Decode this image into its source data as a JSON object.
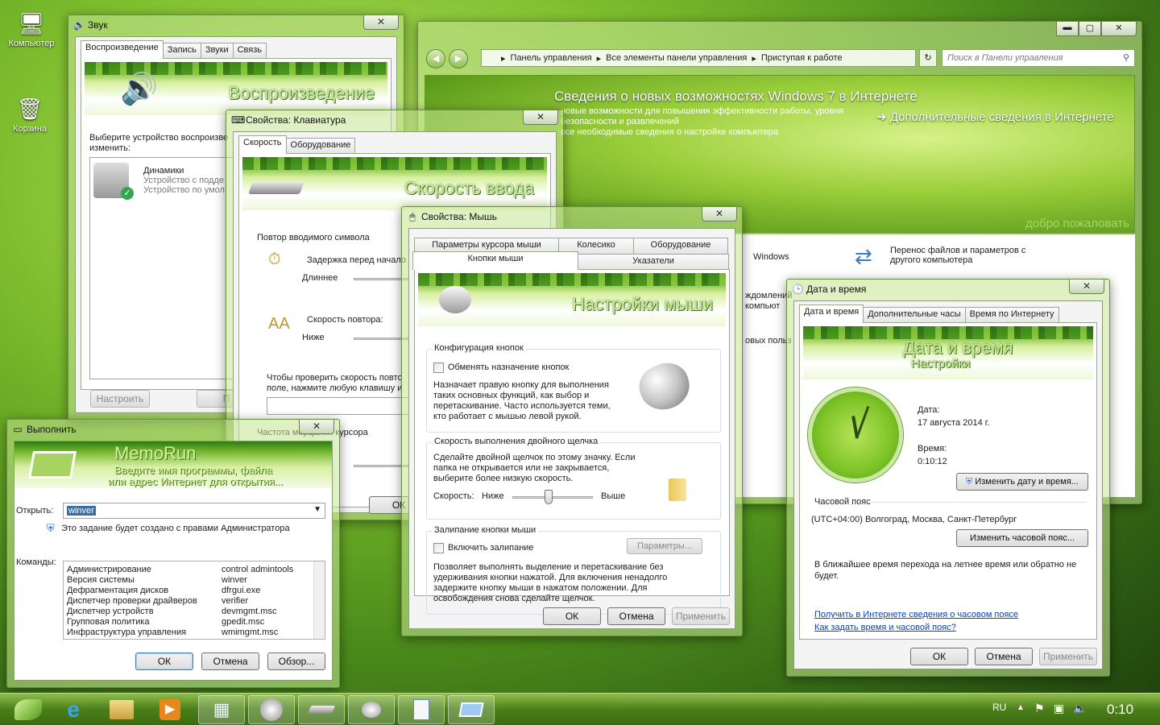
{
  "desktop": {
    "icons": [
      {
        "label": "Компьютер",
        "glyph": "🖥"
      },
      {
        "label": "Корзина",
        "glyph": "🗑"
      }
    ]
  },
  "sound": {
    "title": "Звук",
    "tabs": [
      "Воспроизведение",
      "Запись",
      "Звуки",
      "Связь"
    ],
    "banner": "Воспроизведение",
    "prompt": "Выберите устройство воспроизве",
    "prompt2": "изменить:",
    "device_name": "Динамики",
    "device_line1": "Устройство с подде",
    "device_line2": "Устройство по умол",
    "configure_btn": "Настроить",
    "btn2": "П"
  },
  "keyboard": {
    "title": "Свойства: Клавиатура",
    "tabs": [
      "Скорость",
      "Оборудование"
    ],
    "banner": "Скорость ввода",
    "group_repeat": "Повтор вводимого символа",
    "delay_label": "Задержка перед начало",
    "longer": "Длиннее",
    "repeat_label": "Скорость повтора:",
    "lower": "Ниже",
    "test_line1": "Чтобы проверить скорость повто",
    "test_line2": "поле, нажмите любую клавишу и",
    "cursor_blink": "Частота мерцания курсора",
    "ok_partial": "ОК"
  },
  "mouse": {
    "title": "Свойства: Мышь",
    "tabs_top": [
      "Параметры курсора мыши",
      "Колесико",
      "Оборудование"
    ],
    "tabs_bottom": [
      "Кнопки мыши",
      "Указатели"
    ],
    "banner": "Настройки мыши",
    "grp_buttons": "Конфигурация кнопок",
    "swap_label": "Обменять назначение кнопок",
    "swap_desc": [
      "Назначает правую кнопку для выполнения",
      "таких основных функций, как выбор и",
      "перетаскивание. Часто используется теми,",
      "кто работает с мышью левой рукой."
    ],
    "grp_dbl": "Скорость выполнения двойного щелчка",
    "dbl_desc": [
      "Сделайте двойной щелчок по этому значку. Если",
      "папка не открывается или не закрывается,",
      "выберите более низкую скорость."
    ],
    "speed": "Скорость:",
    "low": "Ниже",
    "high": "Выше",
    "speed_value": 0.45,
    "grp_lock": "Залипание кнопки мыши",
    "lock_label": "Включить залипание",
    "params_btn": "Параметры...",
    "lock_desc": [
      "Позволяет выполнять выделение и перетаскивание без",
      "удерживания кнопки нажатой. Для включения ненадолго",
      "задержите кнопку мыши в нажатом положении. Для",
      "освобождения снова сделайте щелчок."
    ],
    "ok": "ОК",
    "cancel": "Отмена",
    "apply": "Применить"
  },
  "cpanel": {
    "path": [
      "Панель управления",
      "Все элементы панели управления",
      "Приступая к работе"
    ],
    "search_placeholder": "Поиск в Панели управления",
    "headline": "Сведения о новых возможностях Windows 7 в Интернете",
    "sub1": "новые возможности для повышения эффективности работы, уровня",
    "sub2": "безопасности и развлечений",
    "sub3": "все необходимые сведения о настройке компьютера",
    "more": "Дополнительные сведения в Интернете",
    "welcome": "добро пожаловать",
    "item_windows": "Windows",
    "item_transfer1": "Перенос файлов и параметров с",
    "item_transfer2": "другого компьютера",
    "frag1": "ждомлений",
    "frag2": "компьют",
    "frag3": "овых польз"
  },
  "datetime": {
    "title": "Дата и время",
    "tabs": [
      "Дата и время",
      "Дополнительные часы",
      "Время по Интернету"
    ],
    "banner1": "Дата и время",
    "banner2": "Настройки",
    "date_label": "Дата:",
    "date_value": "17 августа 2014 г.",
    "time_label": "Время:",
    "time_value": "0:10:12",
    "change_dt": "Изменить дату и время...",
    "tz_label": "Часовой пояс",
    "tz_value": "(UTC+04:00) Волгоград, Москва, Санкт-Петербург",
    "change_tz": "Изменить часовой пояс...",
    "dst_line1": "В ближайшее время перехода на летнее время или обратно не",
    "dst_line2": "будет.",
    "link1": "Получить в Интернете сведения о часовом поясе",
    "link2": "Как задать время и часовой пояс?",
    "ok": "ОК",
    "cancel": "Отмена",
    "apply": "Применить"
  },
  "run": {
    "title": "Выполнить",
    "banner_title": "MemoRun",
    "banner_sub1": "Введите имя программы, файла",
    "banner_sub2": "или адрес Интернет для открытия...",
    "open_label": "Открыть:",
    "open_value": "winver",
    "admin_note": "Это задание будет создано с правами Администратора",
    "commands_label": "Команды:",
    "commands": [
      [
        "Администрирование",
        "control admintools"
      ],
      [
        "Версия системы",
        "winver"
      ],
      [
        "Дефрагментация дисков",
        "dfrgui.exe"
      ],
      [
        "Диспетчер проверки драйверов",
        "verifier"
      ],
      [
        "Диспетчер устройств",
        "devmgmt.msc"
      ],
      [
        "Групповая политика",
        "gpedit.msc"
      ],
      [
        "Инфраструктура управления",
        "wmimgmt.msc"
      ]
    ],
    "ok": "ОК",
    "cancel": "Отмена",
    "browse": "Обзор..."
  },
  "taskbar": {
    "lang": "RU",
    "clock": "0:10",
    "items": [
      "start-icon",
      "ie-icon",
      "explorer-icon",
      "media-player-icon",
      "control-panel-icon",
      "sound-icon",
      "keyboard-icon",
      "mouse-icon",
      "document-icon",
      "run-icon"
    ]
  }
}
